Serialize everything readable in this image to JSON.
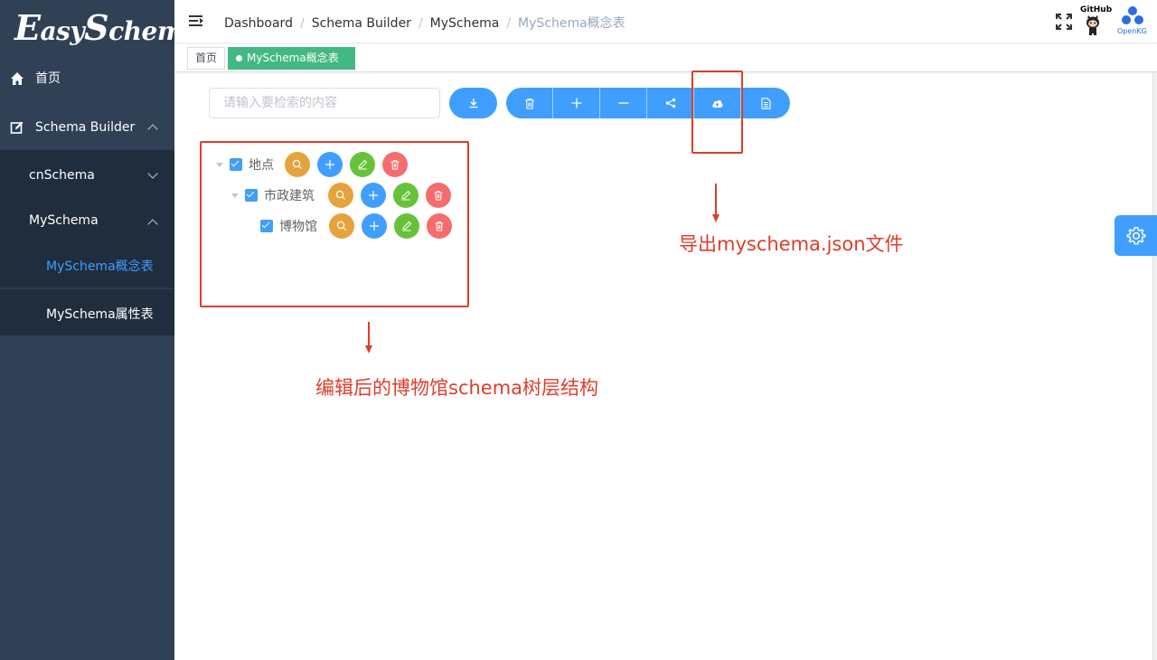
{
  "app": {
    "logo_prefix": "E",
    "logo_mid": "asy",
    "logo_s": "S",
    "logo_rest": "chema"
  },
  "sidebar": {
    "home_label": "首页",
    "schema_builder_label": "Schema Builder",
    "cnschema_label": "cnSchema",
    "myschema_label": "MySchema",
    "concept_table_label": "MySchema概念表",
    "property_table_label": "MySchema属性表",
    "active_color": "#409eff",
    "bg_color": "#304156"
  },
  "header": {
    "breadcrumbs": [
      "Dashboard",
      "Schema Builder",
      "MySchema",
      "MySchema概念表"
    ],
    "github_label": "GitHub",
    "openkg_label": "OpenKG"
  },
  "tags": {
    "home": "首页",
    "active": "MySchema概念表",
    "close": "×",
    "active_color": "#42b983"
  },
  "toolbar": {
    "search_placeholder": "请输入要检索的内容",
    "buttons": [
      "download-icon",
      "delete-icon",
      "plus-icon",
      "minus-icon",
      "share-icon",
      "cloud-upload-icon",
      "document-icon"
    ]
  },
  "tree": {
    "nodes": [
      {
        "label": "地点",
        "level": 0,
        "checked": true,
        "expanded": true
      },
      {
        "label": "市政建筑",
        "level": 1,
        "checked": true,
        "expanded": true
      },
      {
        "label": "博物馆",
        "level": 2,
        "checked": true,
        "expanded": false
      }
    ],
    "action_icons": [
      "search-icon",
      "plus-icon",
      "edit-icon",
      "delete-icon"
    ]
  },
  "annotations": {
    "export_text": "导出myschema.json文件",
    "tree_text": "编辑后的博物馆schema树层结构",
    "color": "#e03c2a"
  }
}
